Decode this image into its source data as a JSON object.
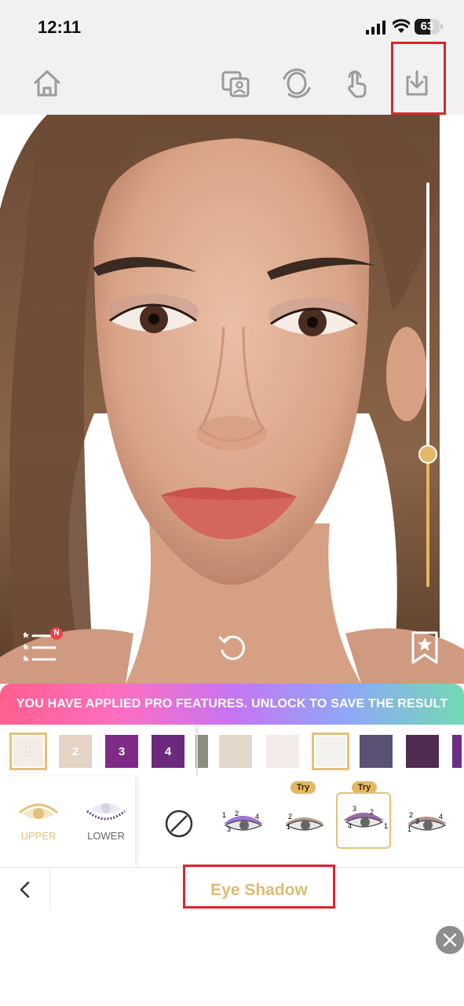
{
  "status_bar": {
    "time": "12:11",
    "battery_level": "63",
    "battery_fraction": 0.63,
    "icons": [
      "signal-icon",
      "wifi-icon",
      "battery-icon"
    ]
  },
  "toolbar": {
    "icons": [
      "home-icon",
      "compare-photo-icon",
      "face-swap-icon",
      "touch-icon",
      "download-icon"
    ],
    "highlighted": "download-icon"
  },
  "photo": {
    "intensity_level": 0.33,
    "icons": [
      "look-list-icon",
      "reset-icon",
      "bookmark-star-icon"
    ],
    "list_badge": "N"
  },
  "pro_banner": {
    "text": "YOU HAVE APPLIED PRO FEATURES. UNLOCK TO SAVE THE RESULT"
  },
  "palette": {
    "left_swatches": [
      {
        "label": "1",
        "color": "#f3ede6",
        "selected": true
      },
      {
        "label": "2",
        "color": "#e3d4c3",
        "selected": false
      },
      {
        "label": "3",
        "color": "#7f2a86",
        "selected": false
      },
      {
        "label": "4",
        "color": "#6c2a7c",
        "selected": false
      }
    ],
    "right_swatches": [
      {
        "color": "#8a8c80",
        "selected": false
      },
      {
        "color": "#e4d7cb",
        "selected": false
      },
      {
        "color": "#f3eaea",
        "selected": false
      },
      {
        "color": "#f4f2ef",
        "selected": true
      },
      {
        "color": "#5b5175",
        "selected": false
      },
      {
        "color": "#4f2b4f",
        "selected": false
      },
      {
        "color": "#6b2d86",
        "selected": false
      }
    ]
  },
  "eye_area": {
    "upper_label": "UPPER",
    "lower_label": "LOWER",
    "selected": "upper"
  },
  "eye_styles": {
    "try_label": "Try",
    "items": [
      "none-icon",
      "style-1",
      "style-2",
      "style-3",
      "style-4"
    ],
    "selected_index": 3
  },
  "bottom_bar": {
    "title": "Eye Shadow"
  },
  "colors": {
    "accent_gold": "#e3b766",
    "highlight_red": "#d9262c"
  }
}
